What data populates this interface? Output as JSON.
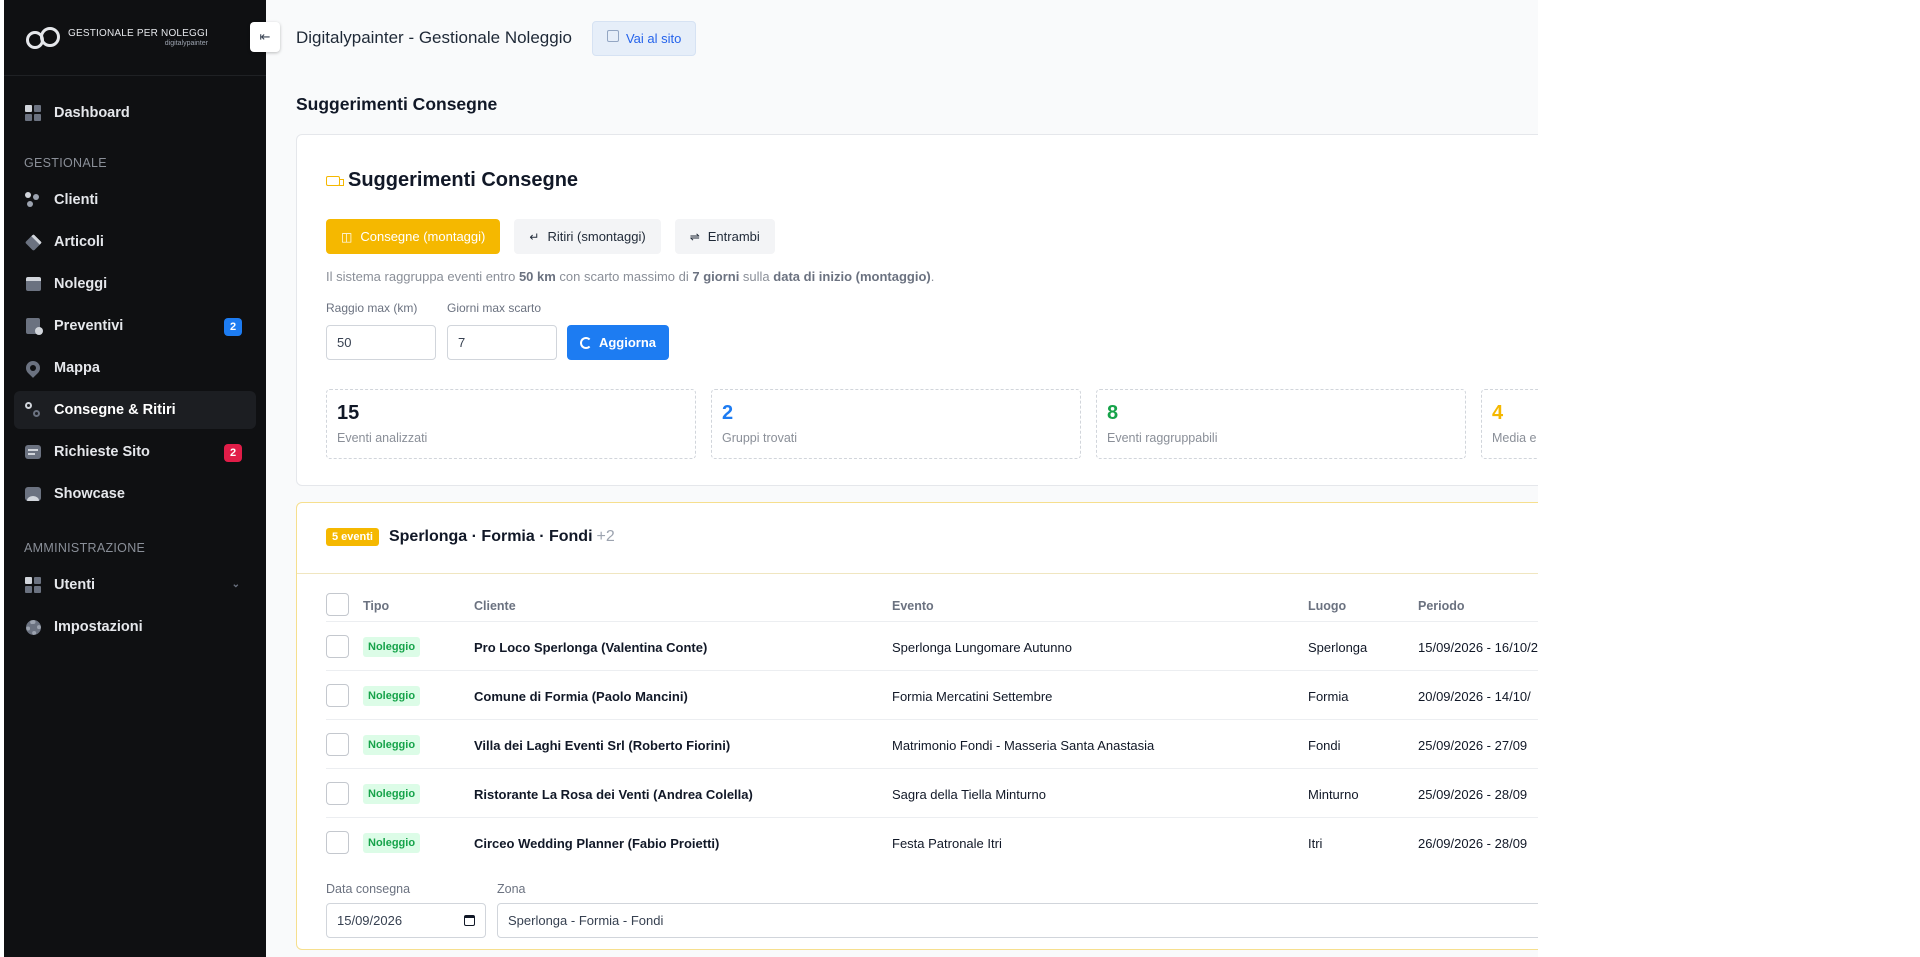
{
  "brand": {
    "line1": "GESTIONALE PER NOLEGGI",
    "line2": "digitalypainter"
  },
  "sidebar": {
    "dashboard": "Dashboard",
    "section_gestionale": "GESTIONALE",
    "gestionale_items": [
      {
        "label": "Clienti",
        "icon": "users-icon"
      },
      {
        "label": "Articoli",
        "icon": "box-icon"
      },
      {
        "label": "Noleggi",
        "icon": "calendar-icon"
      },
      {
        "label": "Preventivi",
        "icon": "document-icon",
        "badge": "2"
      },
      {
        "label": "Mappa",
        "icon": "map-pin-icon"
      },
      {
        "label": "Consegne & Ritiri",
        "icon": "route-icon"
      },
      {
        "label": "Richieste Sito",
        "icon": "chat-icon",
        "badge": "2"
      },
      {
        "label": "Showcase",
        "icon": "image-icon"
      }
    ],
    "section_admin": "AMMINISTRAZIONE",
    "admin_items": [
      {
        "label": "Utenti",
        "icon": "users-icon"
      },
      {
        "label": "Impostazioni",
        "icon": "gear-icon"
      }
    ]
  },
  "header": {
    "title": "Digitalypainter - Gestionale Noleggio",
    "site_button": "Vai al sito"
  },
  "page": {
    "title": "Suggerimenti Consegne"
  },
  "suggestions": {
    "title": "Suggerimenti Consegne",
    "modes": [
      "Consegne (montaggi)",
      "Ritiri (smontaggi)",
      "Entrambi"
    ],
    "info": {
      "p1": "Il sistema raggruppa eventi entro ",
      "km": "50 km",
      "p2": " con scarto massimo di ",
      "days": "7 giorni",
      "p3": " sulla ",
      "basis": "data di inizio (montaggio)",
      "p4": "."
    },
    "radius_label": "Raggio max (km)",
    "radius_value": "50",
    "days_label": "Giorni max scarto",
    "days_value": "7",
    "refresh_button": "Aggiorna",
    "stats": [
      {
        "value": "15",
        "label": "Eventi analizzati",
        "color": "#111827"
      },
      {
        "value": "2",
        "label": "Gruppi trovati",
        "color": "#1d7cf2"
      },
      {
        "value": "8",
        "label": "Eventi raggruppabili",
        "color": "#16a34a"
      },
      {
        "value": "4",
        "label": "Media e",
        "color": "#f5b800"
      }
    ]
  },
  "group": {
    "badge": "5 eventi",
    "title": "Sperlonga · Formia · Fondi",
    "extra": "+2",
    "columns": [
      "Tipo",
      "Cliente",
      "Evento",
      "Luogo",
      "Periodo"
    ],
    "rows": [
      {
        "type": "Noleggio",
        "client": "Pro Loco Sperlonga (Valentina Conte)",
        "event": "Sperlonga Lungomare Autunno",
        "place": "Sperlonga",
        "period": "15/09/2026 - 16/10/2"
      },
      {
        "type": "Noleggio",
        "client": "Comune di Formia (Paolo Mancini)",
        "event": "Formia Mercatini Settembre",
        "place": "Formia",
        "period": "20/09/2026 - 14/10/"
      },
      {
        "type": "Noleggio",
        "client": "Villa dei Laghi Eventi Srl (Roberto Fiorini)",
        "event": "Matrimonio Fondi - Masseria Santa Anastasia",
        "place": "Fondi",
        "period": "25/09/2026 - 27/09"
      },
      {
        "type": "Noleggio",
        "client": "Ristorante La Rosa dei Venti (Andrea Colella)",
        "event": "Sagra della Tiella Minturno",
        "place": "Minturno",
        "period": "25/09/2026 - 28/09"
      },
      {
        "type": "Noleggio",
        "client": "Circeo Wedding Planner (Fabio Proietti)",
        "event": "Festa Patronale Itri",
        "place": "Itri",
        "period": "26/09/2026 - 28/09"
      }
    ],
    "delivery_date_label": "Data consegna",
    "delivery_date_value": "15/09/2026",
    "zone_label": "Zona",
    "zone_value": "Sperlonga - Formia - Fondi"
  }
}
